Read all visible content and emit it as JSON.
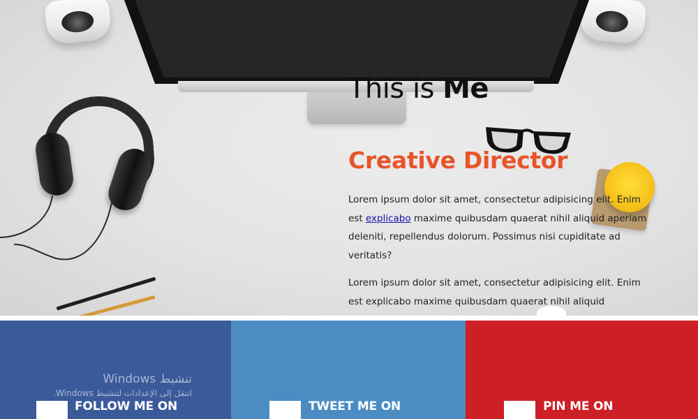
{
  "hero": {
    "headline_prefix": "This is ",
    "headline_bold": "Me",
    "role": "Creative Director",
    "paragraph_1_start": "Lorem ipsum dolor sit amet, consectetur adipisicing elit. Enim est ",
    "paragraph_1_link": "explicabo",
    "paragraph_1_end": " maxime quibusdam quaerat nihil aliquid aperiam deleniti, repellendus dolorum. Possimus nisi cupiditate ad veritatis?",
    "paragraph_2": "Lorem ipsum dolor sit amet, consectetur adipisicing elit. Enim est explicabo maxime quibusdam quaerat nihil aliquid"
  },
  "social": {
    "facebook_label": "FOLLOW ME ON",
    "twitter_label": "TWEET ME ON",
    "pinterest_label": "PIN ME ON"
  },
  "windows_activation": {
    "line_1": "تنشيط Windows",
    "line_2": "انتقل إلى الإعدادات لتنشيط Windows."
  },
  "colors": {
    "accent": "#e8542a",
    "facebook": "#3a5a9a",
    "twitter": "#4b8dc2",
    "pinterest": "#cd1f26"
  },
  "icons": [
    "facebook-icon",
    "twitter-icon",
    "pinterest-icon"
  ]
}
